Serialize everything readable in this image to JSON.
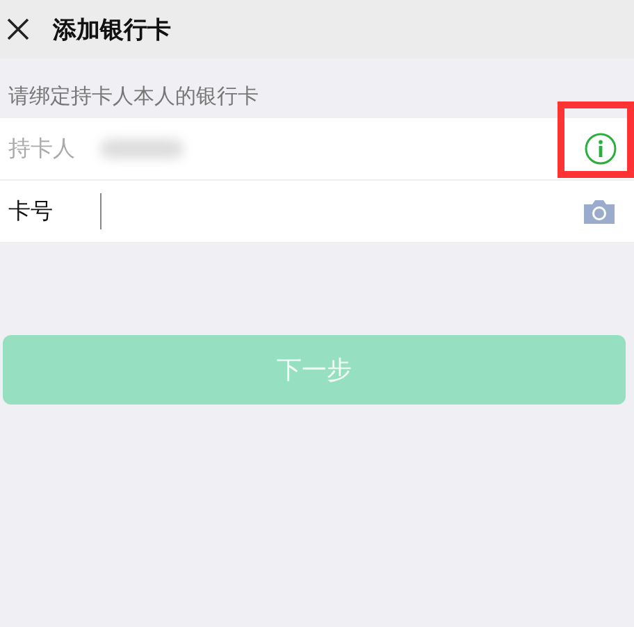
{
  "header": {
    "title": "添加银行卡"
  },
  "notice": "请绑定持卡人本人的银行卡",
  "fields": [
    {
      "kind": "holder",
      "label": "持卡人",
      "redacted": true,
      "highlighted": true
    },
    {
      "kind": "card",
      "label": "卡号",
      "focused": true
    }
  ],
  "next_button": {
    "label": "下一步",
    "disabled": true
  }
}
